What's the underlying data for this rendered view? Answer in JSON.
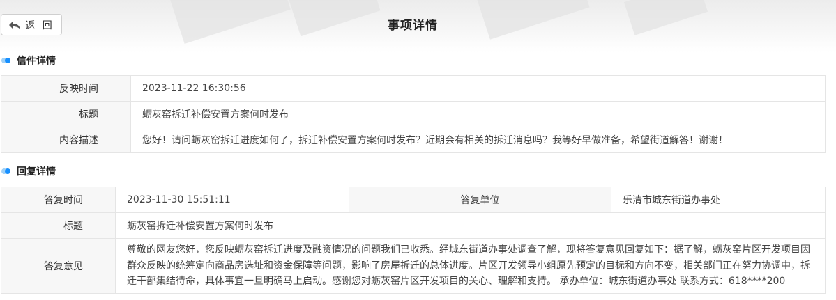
{
  "header": {
    "back_label": "返 回",
    "title": "事项详情"
  },
  "letter": {
    "section_title": "信件详情",
    "rows": [
      {
        "label": "反映时间",
        "value": "2023-11-22 16:30:56"
      },
      {
        "label": "标题",
        "value": "蛎灰窑拆迁补偿安置方案何时发布"
      },
      {
        "label": "内容描述",
        "value": "您好！请问蛎灰窑拆迁进度如何了，拆迁补偿安置方案何时发布？近期会有相关的拆迁消息吗？我等好早做准备，希望街道解答！谢谢！"
      }
    ]
  },
  "reply": {
    "section_title": "回复详情",
    "time_label": "答复时间",
    "time_value": "2023-11-30 15:51:11",
    "unit_label": "答复单位",
    "unit_value": "乐清市城东街道办事处",
    "title_label": "标题",
    "title_value": "蛎灰窑拆迁补偿安置方案何时发布",
    "opinion_label": "答复意见",
    "opinion_value": "尊敬的网友您好，您反映蛎灰窑拆迁进度及融资情况的问题我们已收悉。经城东街道办事处调查了解，现将答复意见回复如下：据了解，蛎灰窑片区开发项目因群众反映的统筹定向商品房选址和资金保障等问题，影响了房屋拆迁的总体进度。片区开发领导小组原先预定的目标和方向不变，相关部门正在努力协调中，拆迁干部集结待命，具体事宜一旦明确马上启动。感谢您对蛎灰窑片区开发项目的关心、理解和支持。 承办单位：城东街道办事处 联系方式：618****200"
  },
  "colors": {
    "accent": "#1890ff",
    "accent_light": "#9fd1f8",
    "label_bg": "#f7f7f7",
    "border": "#e5e5e5"
  },
  "icons": {
    "back": "back-arrow-icon",
    "section": "section-dot-icon"
  }
}
